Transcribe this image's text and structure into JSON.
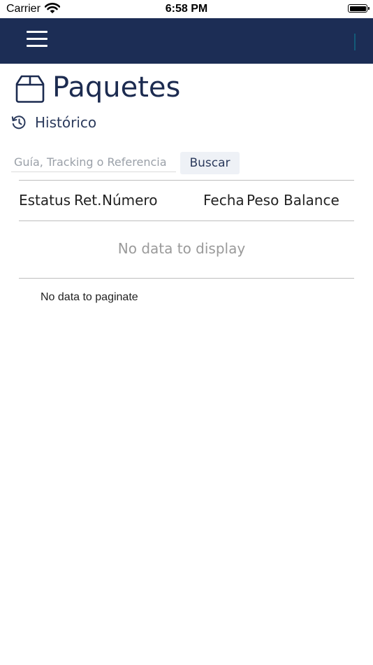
{
  "status_bar": {
    "carrier": "Carrier",
    "time": "6:58 PM",
    "icons": [
      "wifi-icon",
      "battery-icon"
    ]
  },
  "navbar": {
    "background_color": "#1c2d55",
    "menu_icon": "hamburger-menu-icon"
  },
  "page": {
    "title": "Paquetes",
    "title_icon": "package-box-icon",
    "history_label": "Histórico",
    "history_icon": "history-clock-icon"
  },
  "search": {
    "placeholder": "Guía, Tracking o Referencia",
    "value": "",
    "button_label": "Buscar"
  },
  "table": {
    "columns": [
      "Estatus",
      "Ret.",
      "Número",
      "Fecha",
      "Peso",
      "Balance"
    ],
    "rows": [],
    "empty_message": "No data to display"
  },
  "pagination": {
    "message": "No data to paginate"
  },
  "colors": {
    "primary": "#1c2d55",
    "title_text": "#1c2b50",
    "button_bg": "#eef1f6"
  }
}
